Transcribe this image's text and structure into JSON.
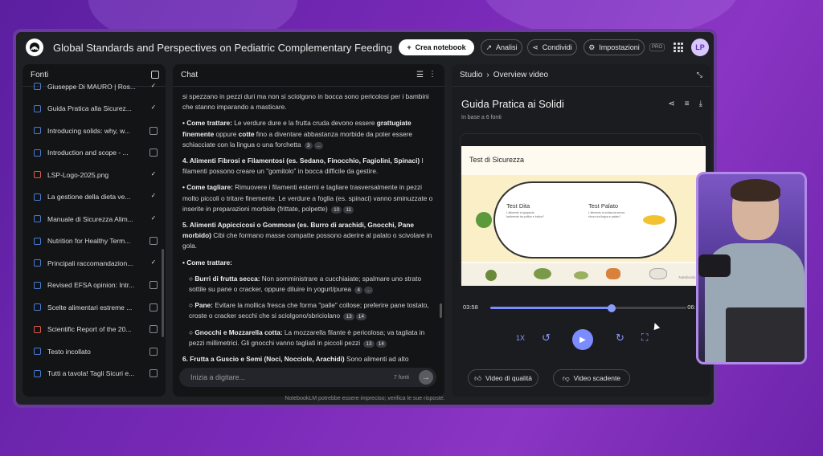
{
  "header": {
    "title": "Global Standards and Perspectives on Pediatric Complementary Feeding",
    "create_label": "Crea notebook",
    "analytics_label": "Analisi",
    "share_label": "Condividi",
    "settings_label": "Impostazioni",
    "pro_badge": "PRO",
    "avatar_initials": "LP"
  },
  "sources": {
    "title": "Fonti",
    "items": [
      {
        "label": "Giuseppe Di MAURO | Ros...",
        "checked": true,
        "color": "#4a7bd6"
      },
      {
        "label": "Guida Pratica alla Sicurez...",
        "checked": true,
        "color": "#4a7bd6"
      },
      {
        "label": "Introducing solids: why, w...",
        "checked": false,
        "color": "#4a7bd6"
      },
      {
        "label": "Introduction and scope - ...",
        "checked": false,
        "color": "#4a7bd6"
      },
      {
        "label": "LSP-Logo-2025.png",
        "checked": true,
        "color": "#e05a4a"
      },
      {
        "label": "La gestione della dieta ve...",
        "checked": true,
        "color": "#4a7bd6"
      },
      {
        "label": "Manuale di Sicurezza Alim...",
        "checked": true,
        "color": "#4a7bd6"
      },
      {
        "label": "Nutrition for Healthy Term...",
        "checked": false,
        "color": "#4a7bd6"
      },
      {
        "label": "Principali raccomandazion...",
        "checked": true,
        "color": "#4a7bd6"
      },
      {
        "label": "Revised EFSA opinion: Intr...",
        "checked": false,
        "color": "#4a7bd6"
      },
      {
        "label": "Scelte alimentari estreme ...",
        "checked": false,
        "color": "#4a7bd6"
      },
      {
        "label": "Scientific Report of the 20...",
        "checked": false,
        "color": "#e05a4a"
      },
      {
        "label": "Testo incollato",
        "checked": false,
        "color": "#4a7bd6"
      },
      {
        "label": "Tutti a tavola! Tagli Sicuri e...",
        "checked": false,
        "color": "#4a7bd6"
      }
    ]
  },
  "chat": {
    "title": "Chat",
    "p0": "si spezzano in pezzi duri ma non si sciolgono in bocca sono pericolosi per i bambini che stanno imparando a masticare.",
    "p1_b": "• Come trattare:",
    "p1_a": " Le verdure dure e la frutta cruda devono essere ",
    "p1_b2": "grattugiate finemente",
    "p1_c": " oppure ",
    "p1_b3": "cotte",
    "p1_d": " fino a diventare abbastanza morbide da poter essere schiacciate con la lingua o una forchetta",
    "p2_b": "4. Alimenti Fibrosi e Filamentosi (es. Sedano, Finocchio, Fagiolini, Spinaci)",
    "p2_a": " I filamenti possono creare un \"gomitolo\" in bocca difficile da gestire.",
    "p3_b": "• Come tagliare:",
    "p3_a": " Rimuovere i filamenti esterni e tagliare trasversalmente in pezzi molto piccoli o tritare finemente. Le verdure a foglia (es. spinaci) vanno sminuzzate o inserite in preparazioni morbide (frittate, polpette)",
    "p4_b": "5. Alimenti Appiccicosi o Gommose (es. Burro di arachidi, Gnocchi, Pane morbido)",
    "p4_a": " Cibi che formano masse compatte possono aderire al palato o scivolare in gola.",
    "p5_b": "• Come trattare:",
    "p6_b": "○ Burri di frutta secca:",
    "p6_a": " Non somministrare a cucchiaiate; spalmare uno strato sottile su pane o cracker, oppure diluire in yogurt/purea",
    "p7_b": "○ Pane:",
    "p7_a": " Evitare la mollica fresca che forma \"palle\" collose; preferire pane tostato, croste o cracker secchi che si sciolgono/sbriciolano",
    "p8_b": "○ Gnocchi e Mozzarella cotta:",
    "p8_a": " La mozzarella filante è pericolosa; va tagliata in pezzi millimetrici. Gli gnocchi vanno tagliati in piccoli pezzi",
    "p9_b": "6. Frutta a Guscio e Semi (Noci, Nocciole, Arachidi)",
    "p9_a": " Sono alimenti ad alto",
    "cites": {
      "c1": "3",
      "c2": "...",
      "c3": "10",
      "c4": "11",
      "c5": "4",
      "c6": "...",
      "c7": "13",
      "c8": "14",
      "c9": "13",
      "c10": "14"
    },
    "input_placeholder": "Inizia a digitare...",
    "sources_count": "7 fonti"
  },
  "studio": {
    "breadcrumb_root": "Studio",
    "breadcrumb_current": "Overview video",
    "video_title": "Guida Pratica ai Solidi",
    "video_sub": "In base a 6 fonti",
    "slide_title": "Test di Sicurezza",
    "test_a_title": "Test Dita",
    "test_a_text": "L'alimento si spappola facilmente tra pollice e indice?",
    "test_b_title": "Test Palato",
    "test_b_text": "L'alimento si schiaccia senza sforzo tra lingua e palato?",
    "watermark": "NotebookLM",
    "time_current": "03:58",
    "time_total": "06:24",
    "progress": 0.62,
    "speed_label": "1X",
    "good_label": "Video di qualità",
    "bad_label": "Video scadente"
  },
  "footer": {
    "disclaimer": "NotebookLM potrebbe essere impreciso; verifica le sue risposte."
  },
  "colors": {
    "accent": "#7b8cff",
    "background": "#1f2023"
  }
}
